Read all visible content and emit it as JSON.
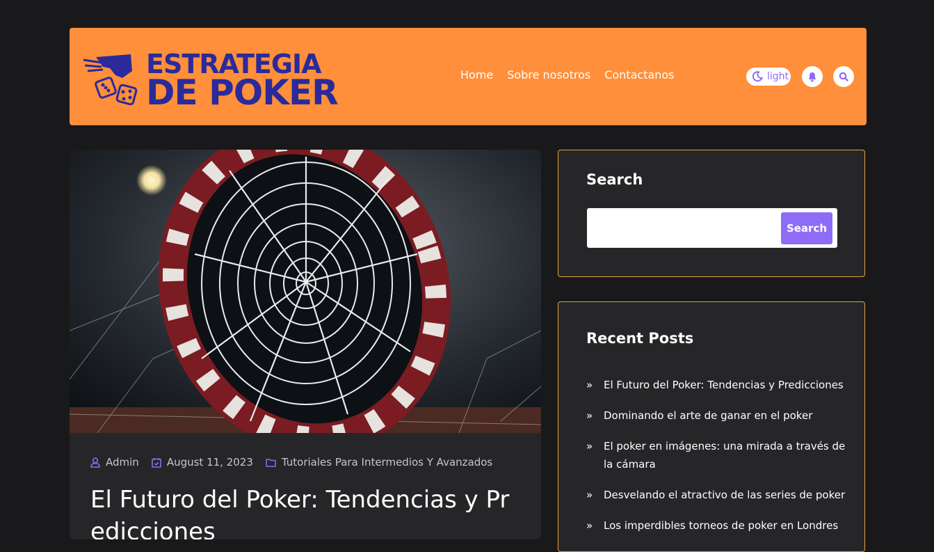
{
  "brand": {
    "line1": "ESTRATEGIA",
    "line2": "DE POKER",
    "color": "#2b2a9a"
  },
  "nav": {
    "items": [
      "Home",
      "Sobre nosotros",
      "Contactanos"
    ]
  },
  "header_actions": {
    "theme_label": "light",
    "theme_icon": "moon-icon",
    "notification_icon": "bell-icon",
    "search_icon": "search-icon"
  },
  "post": {
    "author": "Admin",
    "date": "August 11, 2023",
    "category": "Tutoriales Para Intermedios Y Avanzados",
    "title": "El Futuro del Poker: Tendencias y Predicciones"
  },
  "sidebar": {
    "search": {
      "title": "Search",
      "placeholder": "",
      "button": "Search"
    },
    "recent": {
      "title": "Recent Posts",
      "items": [
        "El Futuro del Poker: Tendencias y Predicciones",
        "Dominando el arte de ganar en el poker",
        "El poker en imágenes: una mirada a través de la cámara",
        "Desvelando el atractivo de las series de poker",
        "Los imperdibles torneos de poker en Londres"
      ]
    }
  },
  "colors": {
    "header_bg": "#ff8f3a",
    "accent": "#8e6cf5",
    "widget_border": "#e0a33c",
    "page_bg": "#19191b",
    "card_bg": "#262629"
  }
}
